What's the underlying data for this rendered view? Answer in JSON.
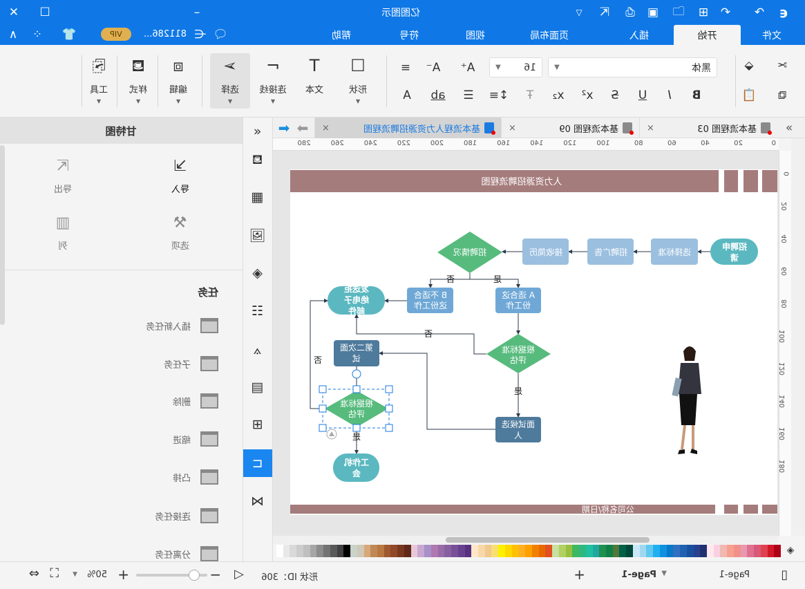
{
  "app": {
    "title": "亿图图示",
    "user": "811286...",
    "vip": "VIP"
  },
  "menu_tabs": [
    {
      "label": "文件"
    },
    {
      "label": "开始",
      "active": true
    },
    {
      "label": "插入"
    },
    {
      "label": "页面布局"
    },
    {
      "label": "视图"
    },
    {
      "label": "符号"
    },
    {
      "label": "帮助"
    }
  ],
  "ribbon": {
    "font_family": "黑体",
    "font_size": "16",
    "tools": {
      "shape": "形状",
      "text": "文本",
      "connector": "连接线",
      "select": "选择",
      "edit": "编辑",
      "style": "样式",
      "tools": "工具"
    }
  },
  "doc_tabs": [
    {
      "label": "基本流程图 03"
    },
    {
      "label": "基本流程图 09"
    },
    {
      "label": "基本流程人力资源招聘流程图",
      "active": true
    }
  ],
  "ruler": {
    "h": [
      "0",
      "20",
      "40",
      "60",
      "80",
      "100",
      "120",
      "140",
      "160",
      "180",
      "200",
      "220",
      "240",
      "260",
      "280"
    ],
    "v": [
      "0",
      "20",
      "40",
      "60",
      "80",
      "100",
      "120",
      "140",
      "160",
      "180"
    ]
  },
  "diagram": {
    "title": "人力资源招聘流程图",
    "footer": "公司名称/日期",
    "shapes": {
      "apply": [
        "招聘申",
        "请"
      ],
      "criteria": [
        "选择标准"
      ],
      "ad": [
        "招聘广告"
      ],
      "resume": [
        "接收简历"
      ],
      "status": [
        "招聘情况"
      ],
      "fit": [
        "A  适合这",
        "份工作"
      ],
      "unfit": [
        "B  不适合",
        "这份工作"
      ],
      "reject": [
        "发送拒",
        "绝电子",
        "邮件"
      ],
      "eval1": [
        "根据标准",
        "评估"
      ],
      "interview": [
        "面试候选",
        "人"
      ],
      "second": [
        "第二次面",
        "试"
      ],
      "eval2": [
        "根据标准",
        "评估"
      ],
      "offer": [
        "工作机",
        "会"
      ]
    },
    "labels": {
      "yes": "是",
      "no": "否"
    },
    "colors": {
      "band": "#a57c7c",
      "teal": "#5bb8c0",
      "light_blue": "#9bbfdf",
      "blue": "#6fa8d6",
      "dark_blue": "#4e7a9c",
      "green": "#57bb7d"
    }
  },
  "gantt_panel": {
    "title": "甘特图",
    "import": "导入",
    "export": "导出",
    "options": "选项",
    "columns": "列",
    "tasks_header": "任务",
    "tasks": [
      "插入新任务",
      "子任务",
      "删除",
      "缩进",
      "凸排",
      "连接任务",
      "分离任务"
    ]
  },
  "status": {
    "page_label": "Page-1",
    "current_page": "Page-1",
    "shape_id": "形状 ID：306",
    "zoom": "50%",
    "zoom_value": 50
  },
  "palette": [
    "#ffffff",
    "#e8e8e8",
    "#d9d9d9",
    "#cccccc",
    "#bfbfbf",
    "#a6a6a6",
    "#8c8c8c",
    "#737373",
    "#595959",
    "#404040",
    "#000000",
    "#c9d3c8",
    "#d0c8b8",
    "#d8a878",
    "#c08858",
    "#b87840",
    "#a05830",
    "#904828",
    "#783820",
    "#602818",
    "#e8c8d8",
    "#c8a8d0",
    "#a890c8",
    "#b078b0",
    "#986ca8",
    "#8860a0",
    "#785098",
    "#684090",
    "#583080",
    "#ffe8c8",
    "#f8d8a8",
    "#f0c890",
    "#f8e070",
    "#fff000",
    "#ffd800",
    "#ffc000",
    "#ffb020",
    "#ffa000",
    "#f08000",
    "#e86800",
    "#e05020",
    "#c8e0a0",
    "#b0d060",
    "#98c040",
    "#40b860",
    "#30b880",
    "#20c0a0",
    "#20a8a0",
    "#209050",
    "#108048",
    "#507838",
    "#006048",
    "#004838",
    "#c8e8f8",
    "#a0d8f0",
    "#60c8f0",
    "#20b0f0",
    "#1090e0",
    "#0878c8",
    "#3070c0",
    "#2060b0",
    "#1850a0",
    "#284090",
    "#203070",
    "#ffe8f0",
    "#f8d0e0",
    "#f0b8b0",
    "#f8a090",
    "#f09088",
    "#e898b0",
    "#e07090",
    "#d85878",
    "#e04050",
    "#d01828",
    "#b00018"
  ]
}
